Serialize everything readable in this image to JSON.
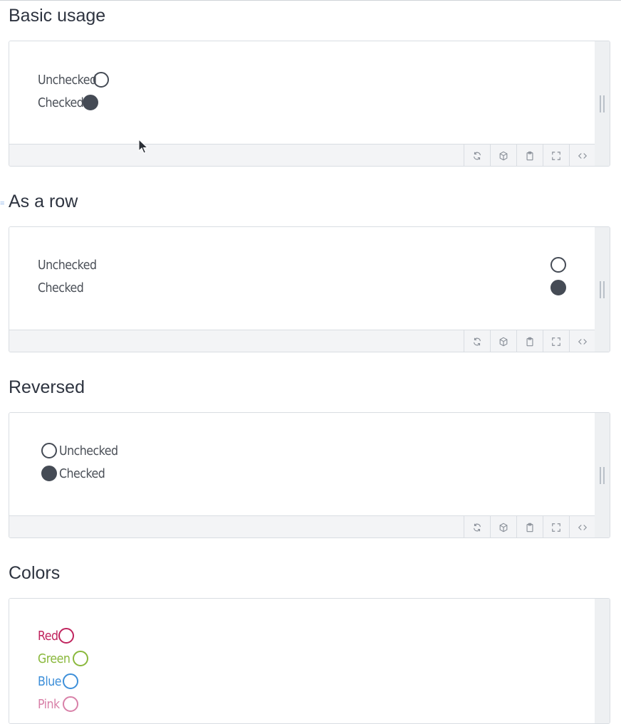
{
  "sections": [
    {
      "title": "Basic usage",
      "options": [
        {
          "label": "Unchecked",
          "checked": false
        },
        {
          "label": "Checked",
          "checked": true
        }
      ]
    },
    {
      "title": "As a row",
      "options": [
        {
          "label": "Unchecked",
          "checked": false
        },
        {
          "label": "Checked",
          "checked": true
        }
      ]
    },
    {
      "title": "Reversed",
      "options": [
        {
          "label": "Unchecked",
          "checked": false
        },
        {
          "label": "Checked",
          "checked": true
        }
      ]
    },
    {
      "title": "Colors",
      "options": [
        {
          "label": "Red",
          "color": "#c0245e"
        },
        {
          "label": "Green",
          "color": "#8ab83c"
        },
        {
          "label": "Blue",
          "color": "#3d8fd9"
        },
        {
          "label": "Pink",
          "color": "#d880a8"
        }
      ]
    }
  ],
  "toolbar_icons": [
    "refresh-icon",
    "cube-icon",
    "clipboard-icon",
    "fullscreen-icon",
    "code-icon"
  ],
  "colors": {
    "radio_default": "#454b55",
    "toolbar_bg": "#f3f4f6",
    "border": "#d9dde2"
  }
}
